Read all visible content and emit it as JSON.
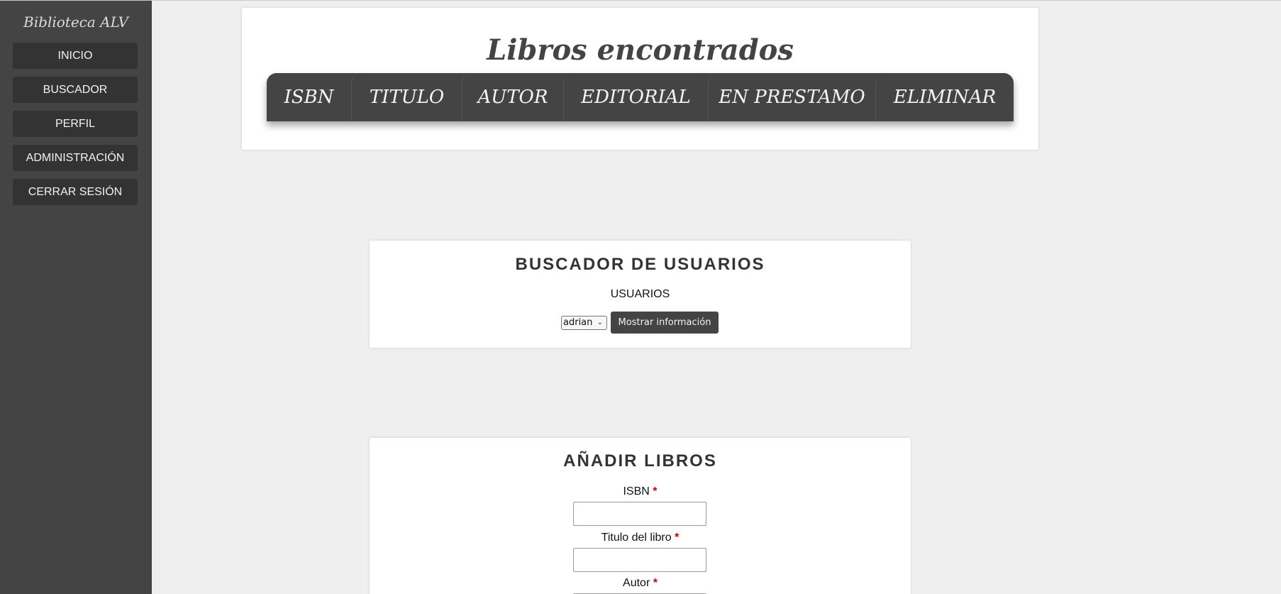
{
  "sidebar": {
    "brand": "Biblioteca ALV",
    "items": [
      {
        "label": "INICIO"
      },
      {
        "label": "BUSCADOR"
      },
      {
        "label": "PERFIL"
      },
      {
        "label": "ADMINISTRACIÓN"
      },
      {
        "label": "CERRAR SESIÓN"
      }
    ]
  },
  "results": {
    "title": "Libros encontrados",
    "tabs": [
      {
        "label": "ISBN"
      },
      {
        "label": "TITULO"
      },
      {
        "label": "AUTOR"
      },
      {
        "label": "EDITORIAL"
      },
      {
        "label": "EN PRESTAMO"
      },
      {
        "label": "ELIMINAR"
      }
    ]
  },
  "user_search": {
    "heading": "BUSCADOR DE USUARIOS",
    "label": "USUARIOS",
    "selected_user": "adrian",
    "button_label": "Mostrar información"
  },
  "add_books": {
    "heading": "AÑADIR LIBROS",
    "required_marker": "*",
    "fields": [
      {
        "label": "ISBN",
        "value": ""
      },
      {
        "label": "Titulo del libro",
        "value": ""
      },
      {
        "label": "Autor",
        "value": ""
      }
    ]
  },
  "colors": {
    "sidebar_bg": "#444444",
    "page_bg": "#efefef",
    "required": "#d10000"
  }
}
